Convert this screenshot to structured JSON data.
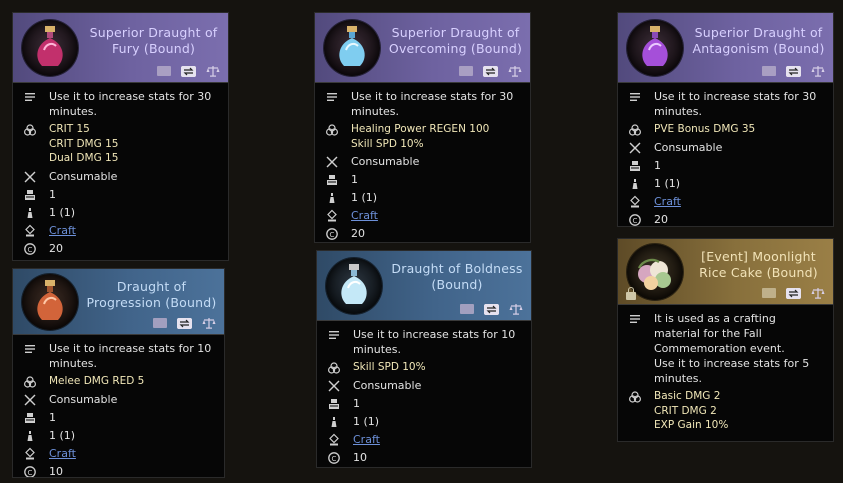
{
  "colors": {
    "page_bg": "#15130f",
    "header_purple": "#6e62a0",
    "header_blue": "#41648a",
    "header_gold": "#88703c",
    "stat_text": "#f1e7b8",
    "link": "#6d90d8"
  },
  "cards": {
    "fury": {
      "title": "Superior Draught of Fury (Bound)",
      "description": "Use it to increase stats for 30 minutes.",
      "stats": [
        "CRIT 15",
        "CRIT DMG 15",
        "Dual DMG 15"
      ],
      "type": "Consumable",
      "stack": "1",
      "count": "1 (1)",
      "source": "Craft",
      "value": "20"
    },
    "overcoming": {
      "title": "Superior Draught of Overcoming (Bound)",
      "description": "Use it to increase stats for 30 minutes.",
      "stats": [
        "Healing Power REGEN 100",
        "Skill SPD 10%"
      ],
      "type": "Consumable",
      "stack": "1",
      "count": "1 (1)",
      "source": "Craft",
      "value": "20"
    },
    "antagonism": {
      "title": "Superior Draught of Antagonism (Bound)",
      "description": "Use it to increase stats for 30 minutes.",
      "stats": [
        "PVE Bonus DMG 35"
      ],
      "type": "Consumable",
      "stack": "1",
      "count": "1 (1)",
      "source": "Craft",
      "value": "20"
    },
    "progression": {
      "title": "Draught of Progression (Bound)",
      "description": "Use it to increase stats for 10 minutes.",
      "stats": [
        "Melee DMG RED 5"
      ],
      "type": "Consumable",
      "stack": "1",
      "count": "1 (1)",
      "source": "Craft",
      "value": "10"
    },
    "boldness": {
      "title": "Draught of Boldness (Bound)",
      "description": "Use it to increase stats for 10 minutes.",
      "stats": [
        "Skill SPD 10%"
      ],
      "type": "Consumable",
      "stack": "1",
      "count": "1 (1)",
      "source": "Craft",
      "value": "10"
    },
    "ricecake": {
      "title": "[Event] Moonlight Rice Cake (Bound)",
      "description": "It is used as a crafting material for the Fall Commemoration event.",
      "description2": "Use it to increase stats for 5 minutes.",
      "stats": [
        "Basic DMG 2",
        "CRIT DMG 2",
        "EXP Gain 10%"
      ]
    }
  },
  "icons": [
    "description-lines-icon",
    "stats-triquetra-icon",
    "crossed-swords-icon",
    "stack-icon",
    "flask-count-icon",
    "anvil-craft-icon",
    "coin-icon",
    "book-icon",
    "trade-icon",
    "scale-icon",
    "lock-icon"
  ]
}
